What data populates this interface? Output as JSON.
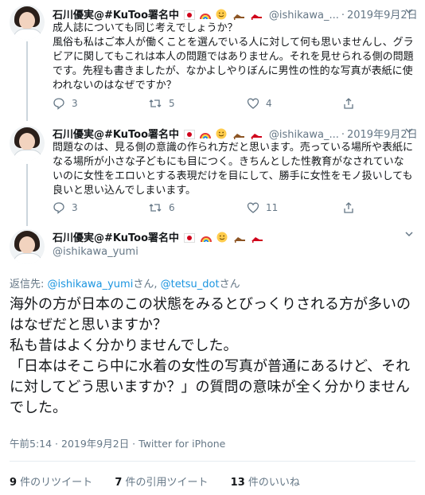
{
  "tweets": [
    {
      "name": "石川優実@#KuToo署名中",
      "handle": "@ishikawa_...",
      "date": "2019年9月2日",
      "text": "成人誌についても同じ考えでしょうか？\n風俗も私はご本人が働くことを選んでいる人に対して何も思いませんし、グラビアに関してもこれは本人の問題ではありません。それを見せられる側の問題です。先程も書きましたが、なかよしやりぼんに男性の性的な写真が表紙に使われないのはなぜですか？",
      "replies": "3",
      "retweets": "5",
      "likes": "4"
    },
    {
      "name": "石川優実@#KuToo署名中",
      "handle": "@ishikawa_...",
      "date": "2019年9月2日",
      "text": "問題なのは、見る側の意識の作られ方だと思います。売っている場所や表紙になる場所が小さな子どもにも目につく。きちんとした性教育がなされていないのに女性をエロいとする表現だけを目にして、勝手に女性をモノ扱いしても良いと思い込んでしまいます。",
      "replies": "3",
      "retweets": "6",
      "likes": "11"
    }
  ],
  "main": {
    "name": "石川優実@#KuToo署名中",
    "handle": "@ishikawa_yumi",
    "reply_prefix": "返信先: ",
    "reply_user1": "@ishikawa_yumi",
    "reply_san1": "さん, ",
    "reply_user2": "@tetsu_dot",
    "reply_san2": "さん",
    "text": "海外の方が日本のこの状態をみるとびっくりされる方が多いのはなぜだと思いますか？\n私も昔はよく分かりませんでした。\n「日本はそこら中に水着の女性の写真が普通にあるけど、それに対してどう思いますか？」の質問の意味が全く分かりませんでした。",
    "meta": "午前5:14 · 2019年9月2日 · Twitter for iPhone",
    "retweet_count": "9",
    "retweet_label": " 件のリツイート",
    "quote_count": "7",
    "quote_label": " 件の引用ツイート",
    "like_count": "13",
    "like_label": " 件のいいね"
  },
  "icons": [
    "reply-icon",
    "retweet-icon",
    "like-icon",
    "share-icon",
    "caret-down-icon",
    "flag-japan-icon",
    "rainbow-icon",
    "smile-emoji-icon",
    "high-heel-icon"
  ],
  "colors": {
    "text": "#14171a",
    "muted": "#657786",
    "link": "#1b95e0",
    "border": "#e6ecf0"
  }
}
